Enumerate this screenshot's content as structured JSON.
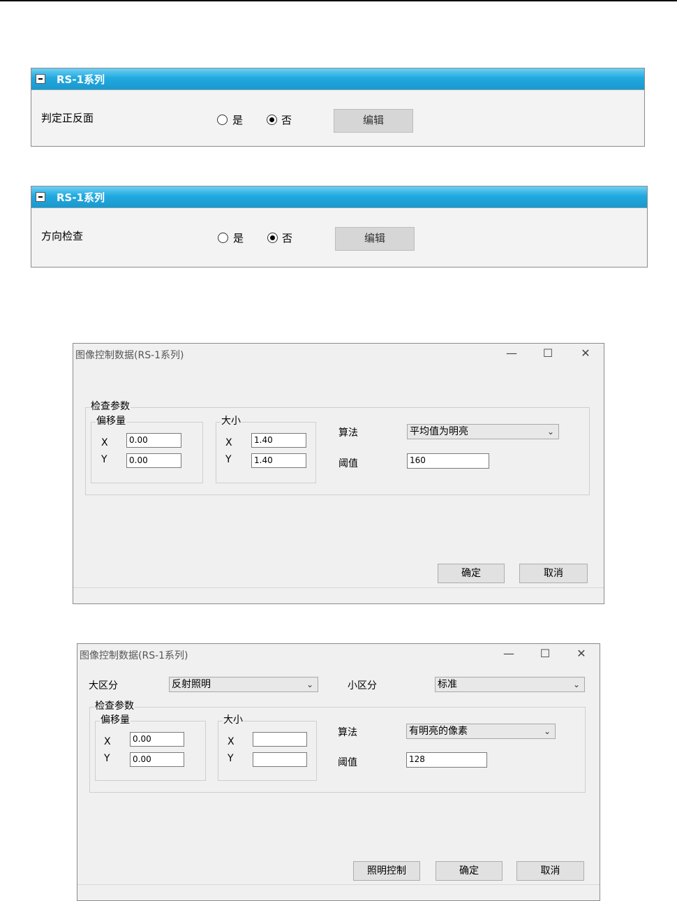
{
  "panel1": {
    "title": "RS-1系列",
    "label": "判定正反面",
    "opt_yes": "是",
    "opt_no": "否",
    "edit": "编辑"
  },
  "panel2": {
    "title": "RS-1系列",
    "label": "方向检查",
    "opt_yes": "是",
    "opt_no": "否",
    "edit": "编辑"
  },
  "dialog1": {
    "title": "图像控制数据(RS-1系列)",
    "window_buttons": {
      "minimize": "—",
      "maximize": "☐",
      "close": "✕"
    },
    "group_inspect": "检查参数",
    "group_offset": "偏移量",
    "group_size": "大小",
    "x_label": "X",
    "y_label": "Y",
    "offset_x": "0.00",
    "offset_y": "0.00",
    "size_x": "1.40",
    "size_y": "1.40",
    "algo_label": "算法",
    "algo_value": "平均值为明亮",
    "threshold_label": "阈值",
    "threshold_value": "160",
    "ok": "确定",
    "cancel": "取消"
  },
  "dialog2": {
    "title": "图像控制数据(RS-1系列)",
    "window_buttons": {
      "minimize": "—",
      "maximize": "☐",
      "close": "✕"
    },
    "major_label": "大区分",
    "major_value": "反射照明",
    "minor_label": "小区分",
    "minor_value": "标准",
    "group_inspect": "检查参数",
    "group_offset": "偏移量",
    "group_size": "大小",
    "x_label": "X",
    "y_label": "Y",
    "offset_x": "0.00",
    "offset_y": "0.00",
    "size_x": "",
    "size_y": "",
    "algo_label": "算法",
    "algo_value": "有明亮的像素",
    "threshold_label": "阈值",
    "threshold_value": "128",
    "lighting": "照明控制",
    "ok": "确定",
    "cancel": "取消"
  },
  "icons": {
    "dropdown": "chevron-down-icon",
    "collapse": "minus-box-icon"
  }
}
